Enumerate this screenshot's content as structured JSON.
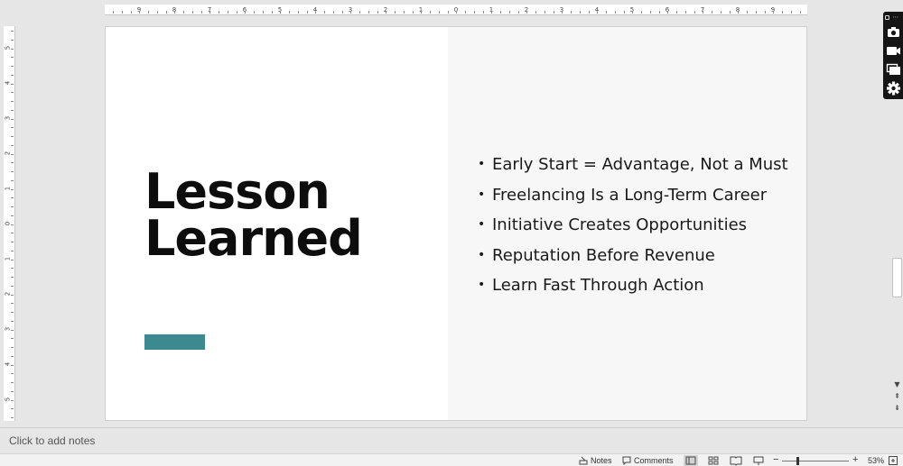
{
  "ruler": {
    "horizontal": [
      "9",
      "8",
      "7",
      "6",
      "5",
      "4",
      "3",
      "2",
      "1",
      "0",
      "1",
      "2",
      "3",
      "4",
      "5",
      "6",
      "7",
      "8",
      "9"
    ],
    "vertical": [
      "5",
      "4",
      "3",
      "2",
      "1",
      "0",
      "1",
      "2",
      "3",
      "4",
      "5"
    ]
  },
  "slide": {
    "title_line1": "Lesson",
    "title_line2": "Learned",
    "accent_color": "#3c8a8f",
    "right_panel_color": "#f7f7f7",
    "bullets": [
      "Early Start = Advantage, Not a Must",
      "Freelancing Is a Long-Term Career",
      "Initiative Creates Opportunities",
      "Reputation Before Revenue",
      "Learn Fast Through Action"
    ]
  },
  "toolbar": {
    "icons": [
      "camera-icon",
      "video-icon",
      "window-icon",
      "gear-icon"
    ],
    "more_label": "⋯"
  },
  "notes": {
    "placeholder": "Click to add notes"
  },
  "statusbar": {
    "notes_label": "Notes",
    "comments_label": "Comments",
    "zoom_label": "53%",
    "zoom_level": 0.53
  }
}
